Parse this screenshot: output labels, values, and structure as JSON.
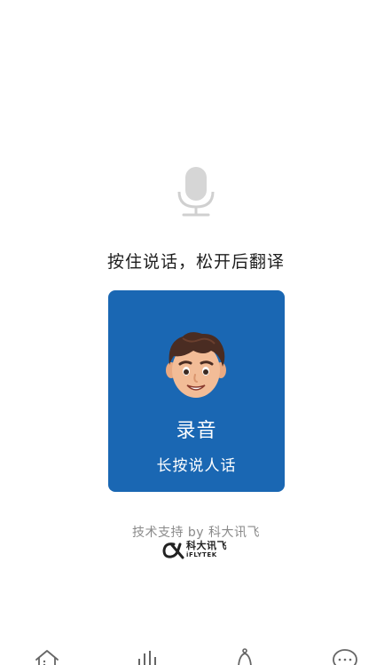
{
  "prompt": {
    "instruction": "按住说话，松开后翻译",
    "mic_icon": "microphone-icon"
  },
  "record_card": {
    "title": "录音",
    "subtitle": "长按说人话",
    "background_color": "#1a67b3",
    "avatar_icon": "cartoon-avatar"
  },
  "footer": {
    "support_text": "技术支持 by 科大讯飞",
    "brand_name_cn": "科大讯飞",
    "brand_name_en": "iFLYTEK",
    "brand_logo_icon": "iflytek-logo"
  },
  "tabbar": {
    "items": [
      {
        "icon": "home-icon"
      },
      {
        "icon": "bar-chart-icon"
      },
      {
        "icon": "bell-icon"
      },
      {
        "icon": "chat-bubble-icon"
      }
    ]
  }
}
